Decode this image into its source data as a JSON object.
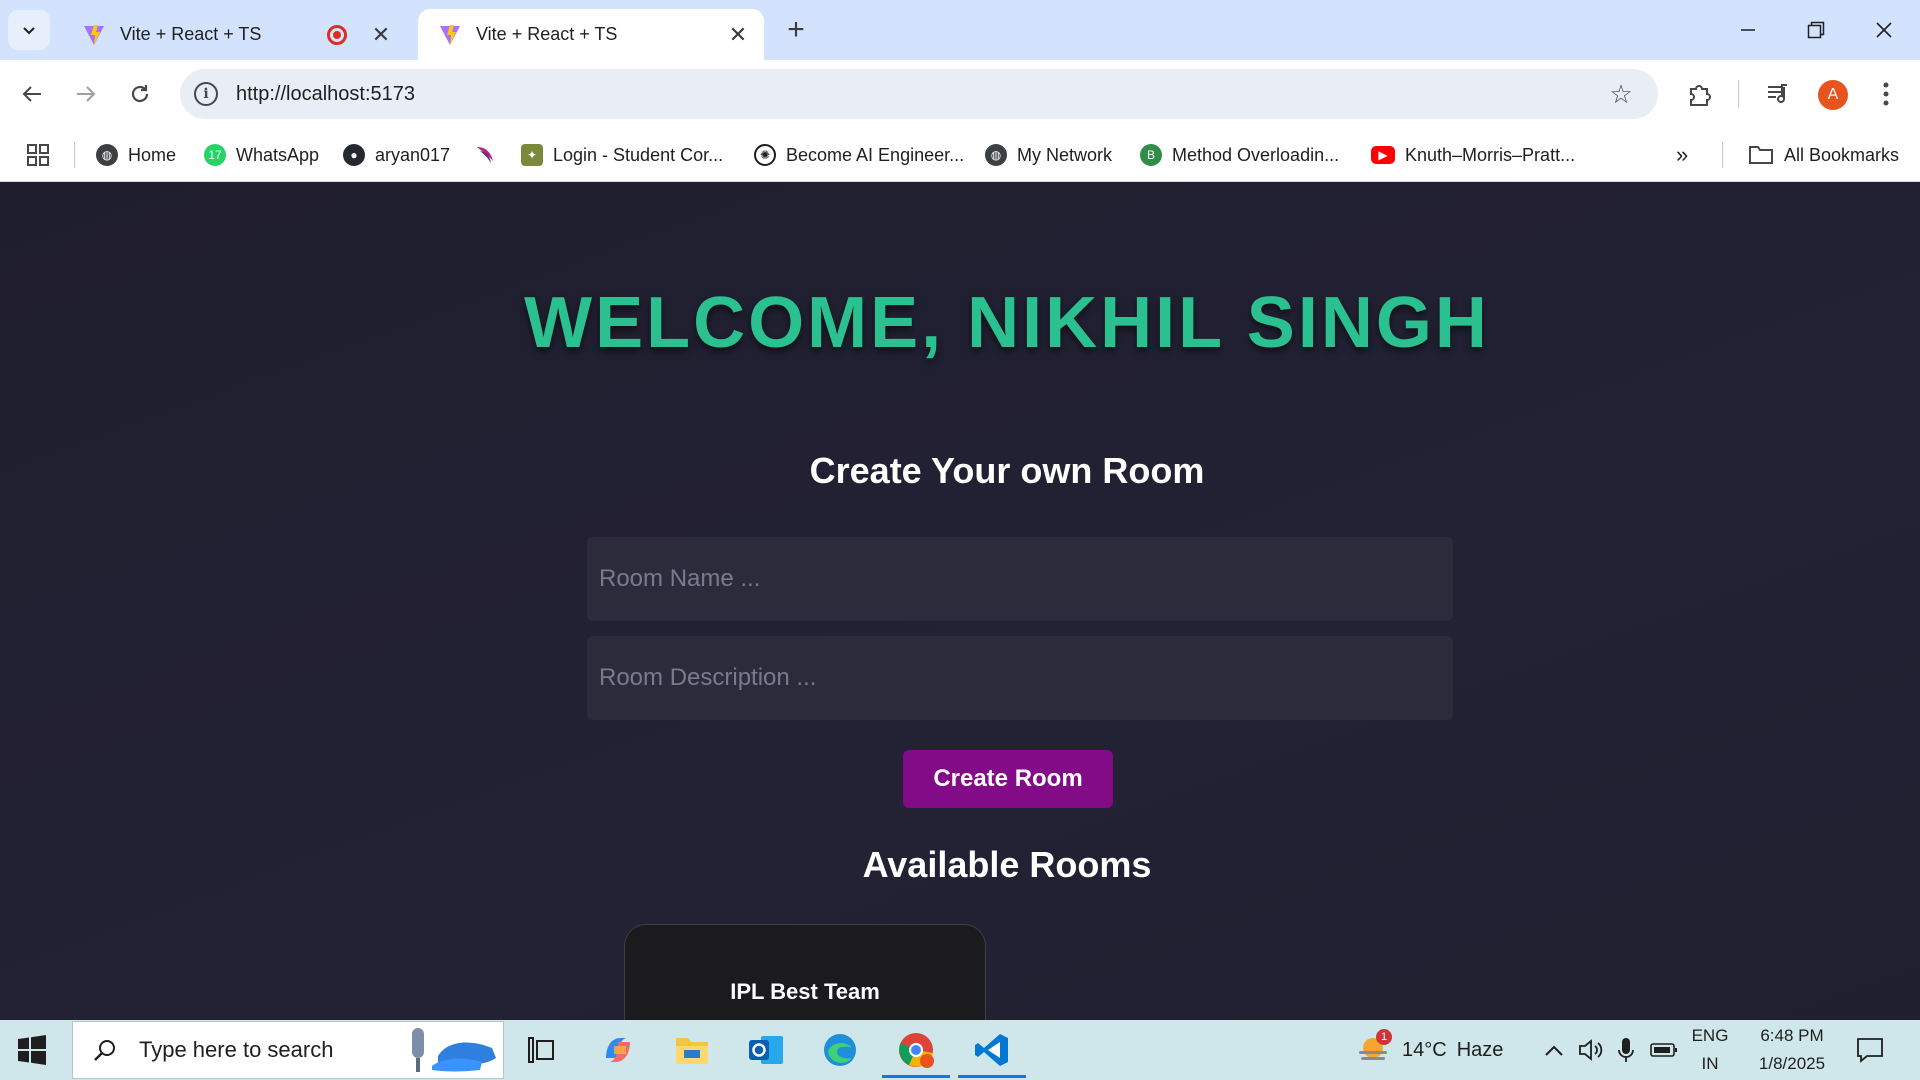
{
  "browser": {
    "tabs": [
      {
        "title": "Vite + React + TS",
        "recording": true
      },
      {
        "title": "Vite + React + TS",
        "active": true
      }
    ],
    "url": "http://localhost:5173",
    "profile_initial": "A"
  },
  "bookmarks": [
    {
      "label": "Home",
      "icon": "globe-icon"
    },
    {
      "label": "WhatsApp",
      "icon": "whatsapp-icon",
      "badge": "17"
    },
    {
      "label": "aryan017",
      "icon": "github-icon"
    },
    {
      "label": "",
      "icon": "swirl-icon"
    },
    {
      "label": "Login - Student Cor...",
      "icon": "emblem-icon"
    },
    {
      "label": "Become AI Engineer...",
      "icon": "openai-icon"
    },
    {
      "label": "My Network",
      "icon": "globe-icon"
    },
    {
      "label": "Method Overloadin...",
      "icon": "b-icon"
    },
    {
      "label": "Knuth–Morris–Pratt...",
      "icon": "youtube-icon"
    }
  ],
  "all_bookmarks_label": "All Bookmarks",
  "page": {
    "welcome": "WELCOME, NIKHIL SINGH",
    "create_heading": "Create Your own Room",
    "room_name_placeholder": "Room Name ...",
    "room_desc_placeholder": "Room Description ...",
    "create_button": "Create Room",
    "available_heading": "Available Rooms",
    "rooms": [
      {
        "name": "IPL Best Team"
      }
    ]
  },
  "colors": {
    "welcome": "#2bc08f",
    "button": "#830b88",
    "page_bg": "#21202f"
  },
  "taskbar": {
    "search_placeholder": "Type here to search",
    "weather": {
      "temp": "14°C",
      "condition": "Haze",
      "badge": "1"
    },
    "lang": {
      "line1": "ENG",
      "line2": "IN"
    },
    "time": "6:48 PM",
    "date": "1/8/2025"
  }
}
